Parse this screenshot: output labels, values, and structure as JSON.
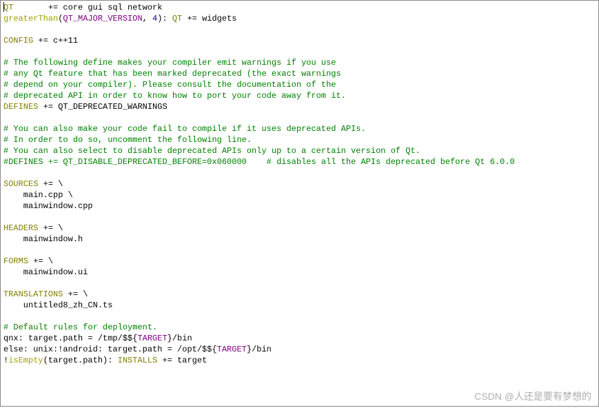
{
  "code": {
    "l1_qt": "QT",
    "l1_rest": "       += core gui sql network",
    "l2_fn": "greaterThan",
    "l2_p1": "(",
    "l2_const": "QT_MAJOR_VERSION",
    "l2_mid": ", ",
    "l2_num": "4",
    "l2_p2": "): ",
    "l2_qt": "QT",
    "l2_rest": " += widgets",
    "blank": "",
    "l4_kw": "CONFIG",
    "l4_rest": " += c++11",
    "c1": "# The following define makes your compiler emit warnings if you use",
    "c2": "# any Qt feature that has been marked deprecated (the exact warnings",
    "c3": "# depend on your compiler). Please consult the documentation of the",
    "c4": "# deprecated API in order to know how to port your code away from it.",
    "l10_kw": "DEFINES",
    "l10_rest": " += QT_DEPRECATED_WARNINGS",
    "c5": "# You can also make your code fail to compile if it uses deprecated APIs.",
    "c6": "# In order to do so, uncomment the following line.",
    "c7": "# You can also select to disable deprecated APIs only up to a certain version of Qt.",
    "c8": "#DEFINES += QT_DISABLE_DEPRECATED_BEFORE=0x060000    # disables all the APIs deprecated before Qt 6.0.0",
    "l17_kw": "SOURCES",
    "l17_rest": " += \\",
    "l18": "    main.cpp \\",
    "l19": "    mainwindow.cpp",
    "l21_kw": "HEADERS",
    "l21_rest": " += \\",
    "l22": "    mainwindow.h",
    "l24_kw": "FORMS",
    "l24_rest": " += \\",
    "l25": "    mainwindow.ui",
    "l27_kw": "TRANSLATIONS",
    "l27_rest": " += \\",
    "l28": "    untitled8_zh_CN.ts",
    "c9": "# Default rules for deployment.",
    "l31_a": "qnx: target.path = /tmp/$${",
    "l31_const": "TARGET",
    "l31_b": "}/bin",
    "l32_a": "else: unix:!android: target.path = /opt/$${",
    "l32_const": "TARGET",
    "l32_b": "}/bin",
    "l33_bang": "!",
    "l33_fn": "isEmpty",
    "l33_a": "(target.path): ",
    "l33_kw": "INSTALLS",
    "l33_b": " += target"
  },
  "watermark": "CSDN @人还是要有梦想的"
}
